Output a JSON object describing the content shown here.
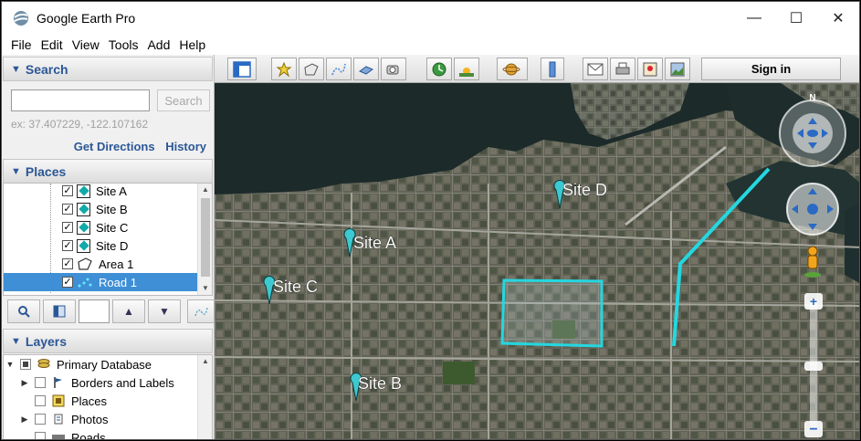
{
  "window": {
    "title": "Google Earth Pro"
  },
  "menu": [
    "File",
    "Edit",
    "View",
    "Tools",
    "Add",
    "Help"
  ],
  "search": {
    "header": "Search",
    "placeholder": "",
    "button_label": "Search",
    "hint": "ex: 37.407229, -122.107162",
    "get_directions": "Get Directions",
    "history": "History"
  },
  "places": {
    "header": "Places",
    "items": [
      {
        "label": "Site A",
        "checked": true,
        "icon": "placemark-icon"
      },
      {
        "label": "Site B",
        "checked": true,
        "icon": "placemark-icon"
      },
      {
        "label": "Site C",
        "checked": true,
        "icon": "placemark-icon"
      },
      {
        "label": "Site D",
        "checked": true,
        "icon": "placemark-icon"
      },
      {
        "label": "Area 1",
        "checked": true,
        "icon": "polygon-icon"
      },
      {
        "label": "Road 1",
        "checked": true,
        "icon": "path-icon",
        "selected": true
      }
    ]
  },
  "layers": {
    "header": "Layers",
    "items": [
      {
        "label": "Primary Database",
        "icon": "database-icon"
      },
      {
        "label": "Borders and Labels",
        "icon": "flag-icon"
      },
      {
        "label": "Places",
        "icon": "places-icon"
      },
      {
        "label": "Photos",
        "icon": "photos-icon"
      },
      {
        "label": "Roads",
        "icon": "roads-icon"
      }
    ]
  },
  "toolbar": {
    "sign_in": "Sign in"
  },
  "map": {
    "pins": [
      {
        "label": "Site A"
      },
      {
        "label": "Site B"
      },
      {
        "label": "Site C"
      },
      {
        "label": "Site D"
      }
    ],
    "compass_north": "N",
    "accent_color": "#24d7e0"
  }
}
